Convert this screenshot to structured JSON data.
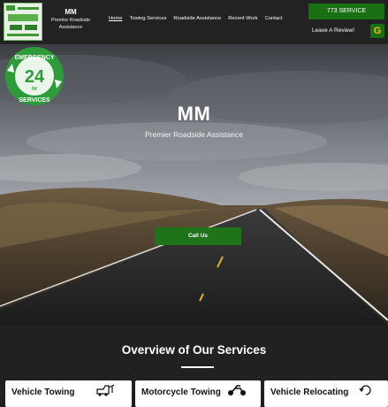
{
  "brand": {
    "name": "MM",
    "subtitle_line1": "Premier Roadside",
    "subtitle_line2": "Assistance"
  },
  "nav": {
    "items": [
      "Home",
      "Towing Services",
      "Roadside Assistance",
      "Recent Work",
      "Contact"
    ],
    "active": "Home"
  },
  "header": {
    "phone_label": "773 SERVICE",
    "review_label": "Leave A Review!",
    "google_icon": "G"
  },
  "hero": {
    "title": "MM",
    "subtitle": "Premier Roadside Assistance",
    "badge": {
      "top": "EMERGENCY",
      "number": "24",
      "unit": "hr",
      "bottom": "SERVICES"
    },
    "cta_label": "Call Us"
  },
  "services": {
    "title": "Overview of Our Services",
    "cards": [
      {
        "title": "Vehicle Towing",
        "icon": "tow-truck-icon"
      },
      {
        "title": "Motorcycle Towing",
        "icon": "motorcycle-icon"
      },
      {
        "title": "Vehicle Relocating",
        "icon": "relocate-icon"
      }
    ]
  },
  "colors": {
    "accent_green": "#1f7318",
    "header_bg": "#222222",
    "section_bg": "#212121"
  }
}
